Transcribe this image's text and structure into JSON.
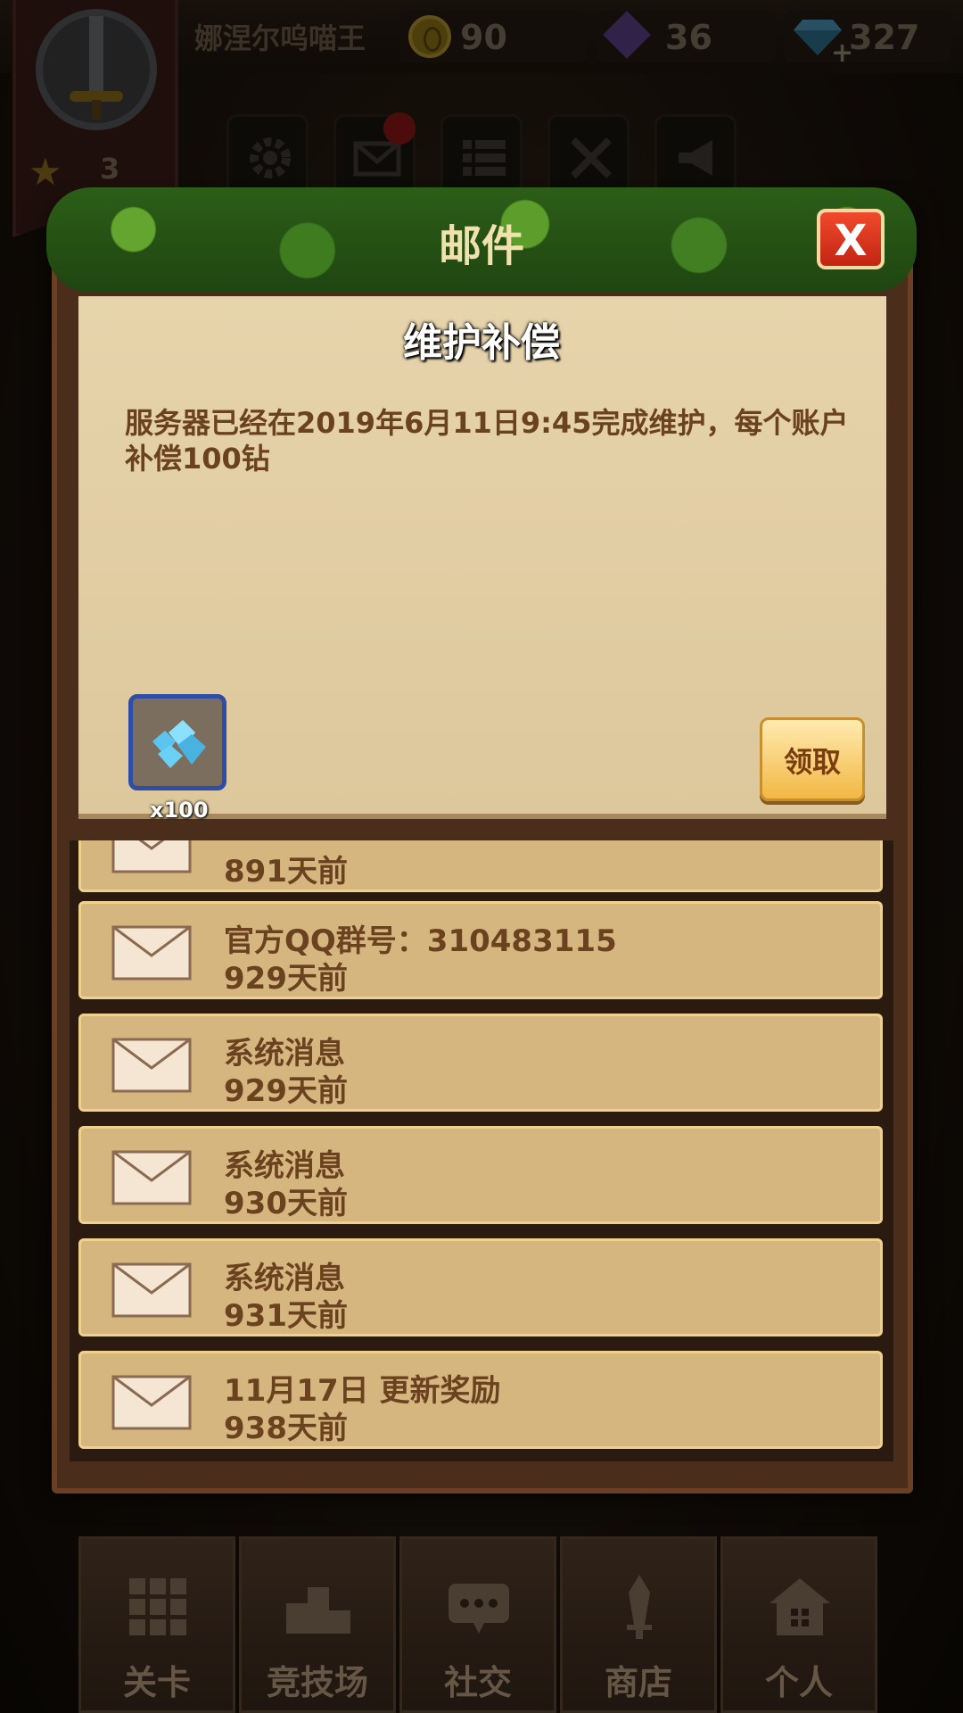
{
  "header": {
    "player_name": "娜涅尔呜喵王",
    "stars": "3",
    "coins": "90",
    "gems": "36",
    "diamonds": "327"
  },
  "toolbar": {
    "icons": [
      "gear-icon",
      "mail-icon",
      "list-icon",
      "swords-icon",
      "horn-icon"
    ]
  },
  "mail_dialog": {
    "title": "邮件",
    "close_label": "X",
    "selected": {
      "subject": "维护补偿",
      "body": "服务器已经在2019年6月11日9:45完成维护，每个账户补偿100钻",
      "attachment_qty": "x100",
      "claim_label": "领取"
    },
    "list": [
      {
        "title": "",
        "time": "891天前"
      },
      {
        "title": "官方QQ群号：310483115",
        "time": "929天前"
      },
      {
        "title": "系统消息",
        "time": "929天前"
      },
      {
        "title": "系统消息",
        "time": "930天前"
      },
      {
        "title": "系统消息",
        "time": "931天前"
      },
      {
        "title": "11月17日 更新奖励",
        "time": "938天前"
      }
    ]
  },
  "nav": {
    "items": [
      {
        "label": "关卡",
        "icon": "grid-icon"
      },
      {
        "label": "竞技场",
        "icon": "podium-icon"
      },
      {
        "label": "社交",
        "icon": "chat-icon"
      },
      {
        "label": "商店",
        "icon": "sword-icon"
      },
      {
        "label": "个人",
        "icon": "house-icon"
      }
    ]
  },
  "colors": {
    "parchment": "#e2cea4",
    "list_row": "#d6b67f",
    "text_brown": "#6b421f",
    "close_red": "#d8331b",
    "claim_gold": "#f2b844"
  }
}
